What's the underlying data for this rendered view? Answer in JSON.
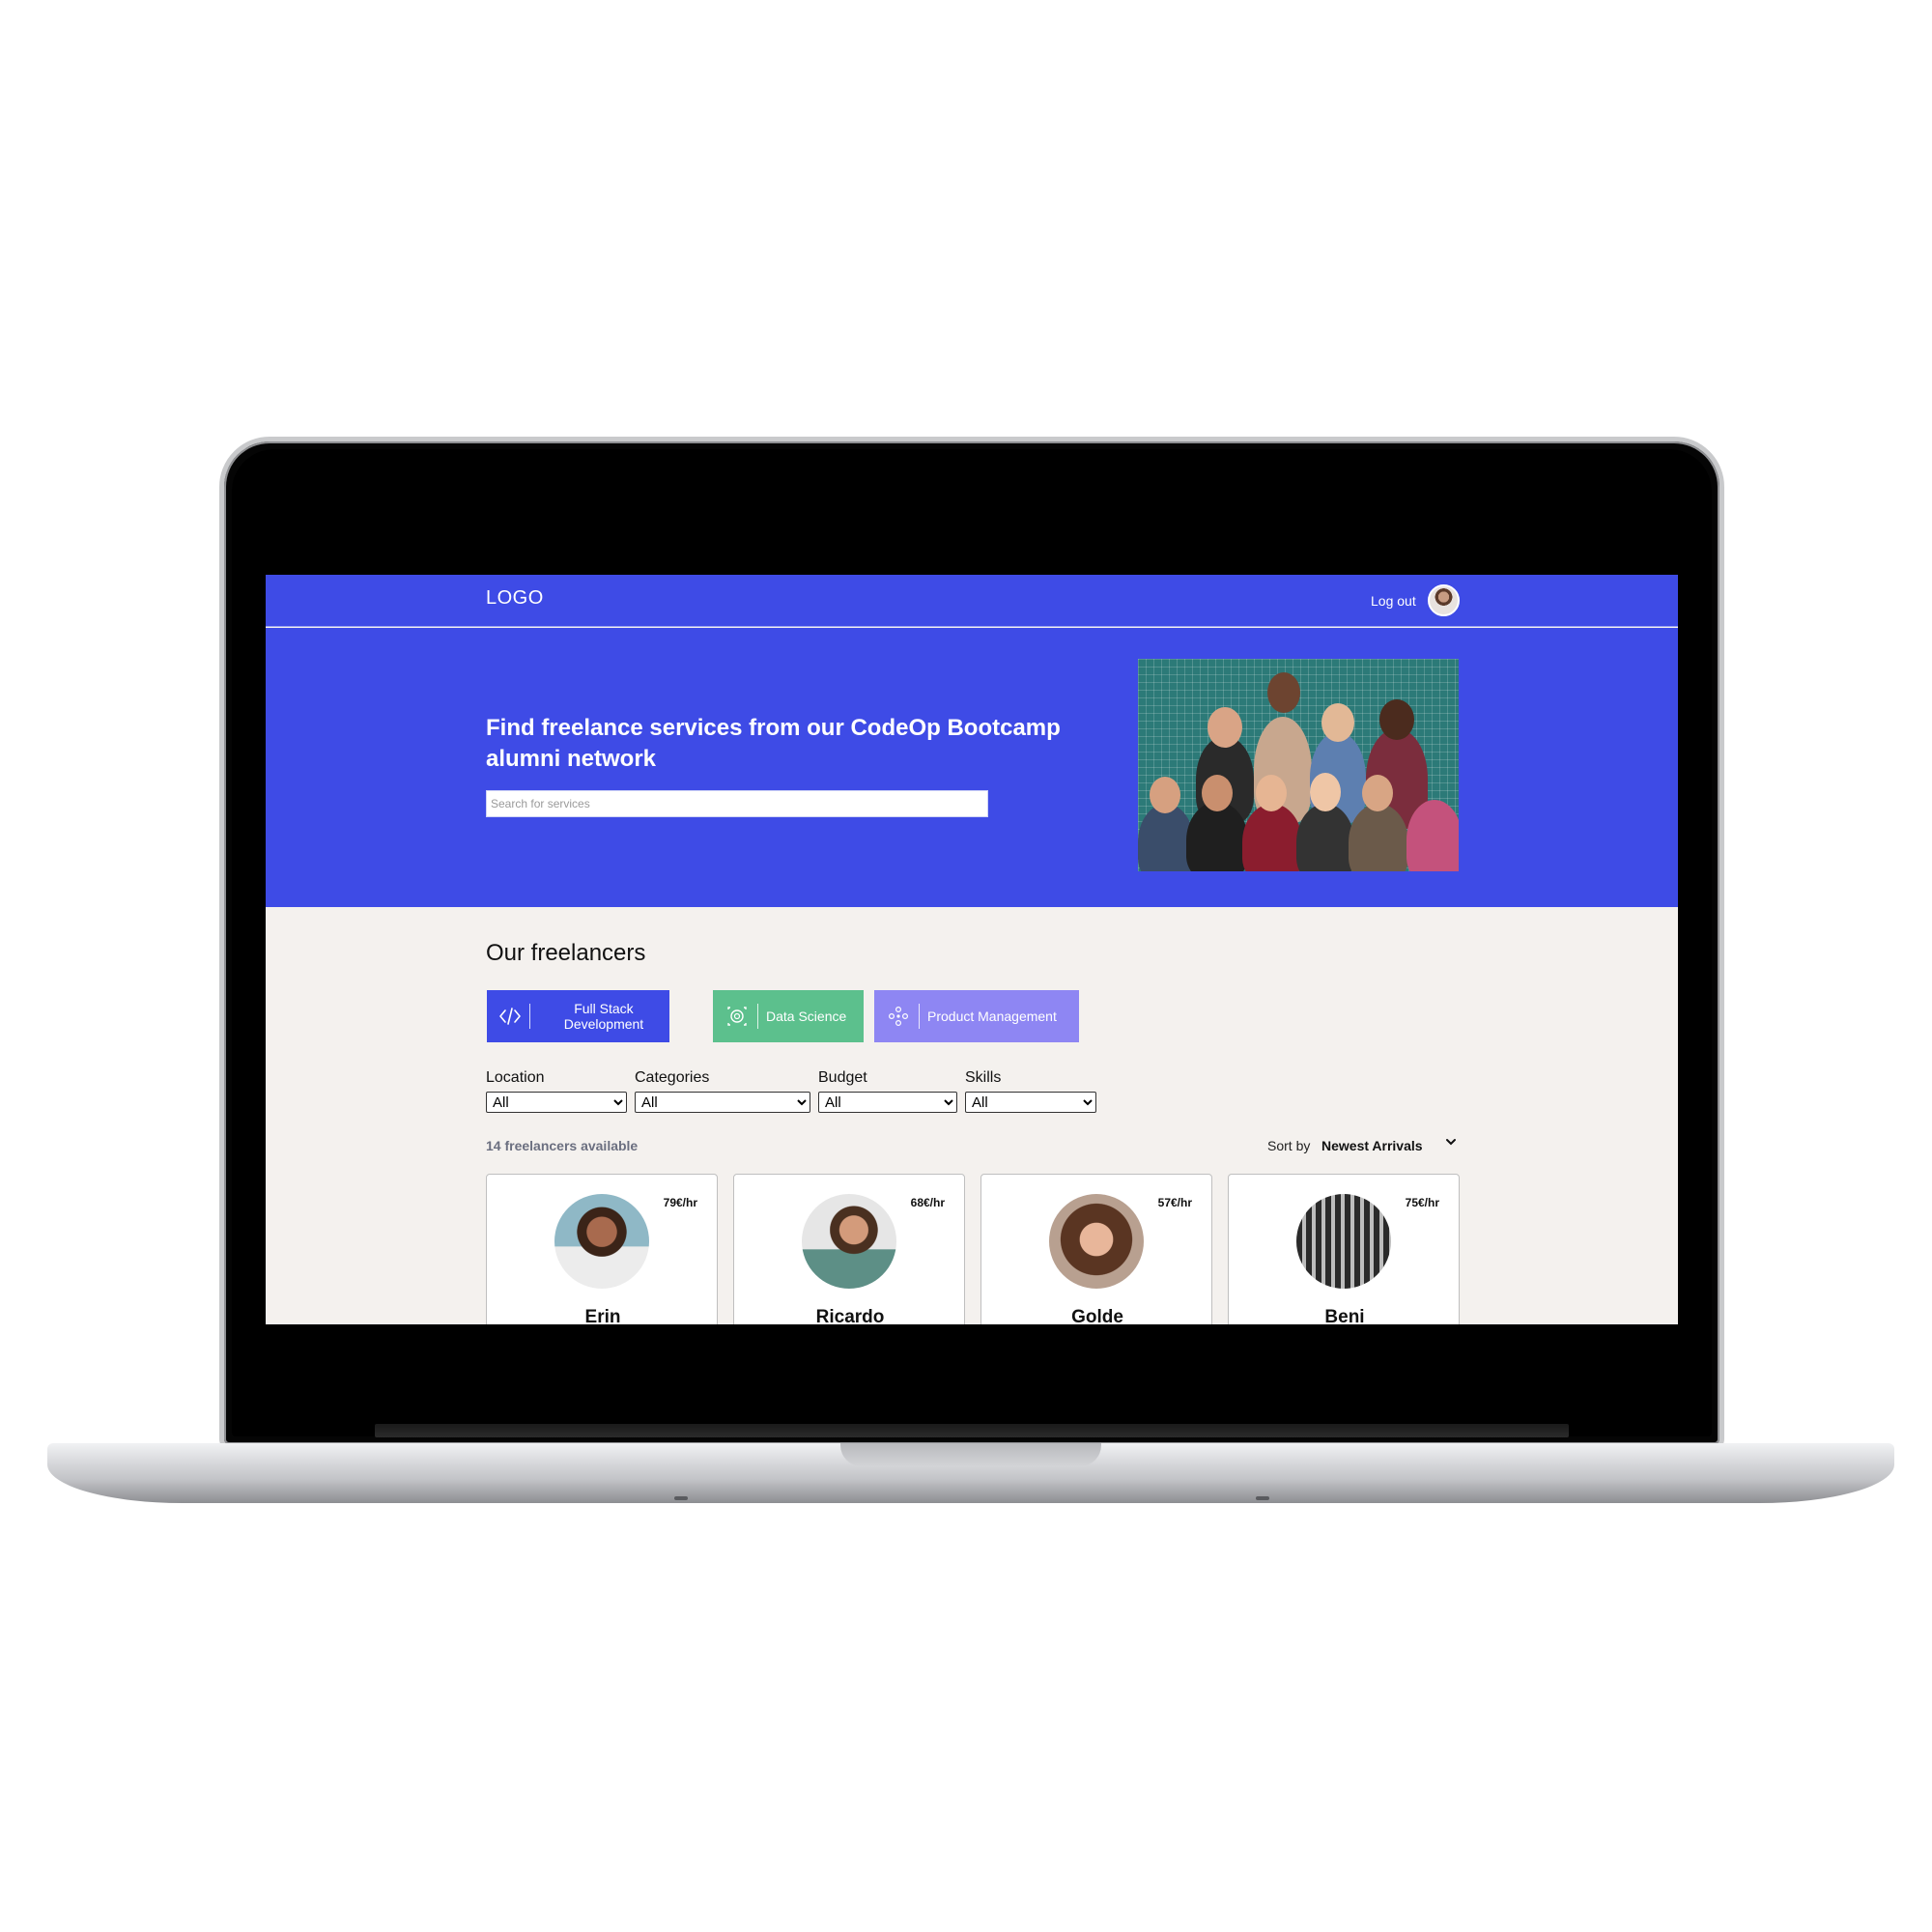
{
  "navbar": {
    "logo": "LOGO",
    "logout_label": "Log out",
    "avatar_icon": "user-avatar",
    "background": "#3e4be6"
  },
  "hero": {
    "title": "Find freelance services from our CodeOp Bootcamp alumni network",
    "search_placeholder": "Search for services",
    "search_value": "",
    "photo": "group-photo"
  },
  "freelancers": {
    "section_title": "Our freelancers",
    "categories": [
      {
        "label": "Full Stack Development",
        "icon": "code-icon",
        "color": "#3e4be6"
      },
      {
        "label": "Data Science",
        "icon": "data-science-icon",
        "color": "#5cc08d"
      },
      {
        "label": "Product Management",
        "icon": "product-management-icon",
        "color": "#8e86f3"
      }
    ],
    "filters": [
      {
        "label": "Location",
        "selected": "All"
      },
      {
        "label": "Categories",
        "selected": "All"
      },
      {
        "label": "Budget",
        "selected": "All"
      },
      {
        "label": "Skills",
        "selected": "All"
      }
    ],
    "count_text": "14 freelancers available",
    "sort": {
      "label": "Sort by",
      "value": "Newest Arrivals",
      "icon": "chevron-down-icon"
    },
    "cards": [
      {
        "name": "Erin",
        "rate": "79€/hr"
      },
      {
        "name": "Ricardo",
        "rate": "68€/hr"
      },
      {
        "name": "Golde",
        "rate": "57€/hr"
      },
      {
        "name": "Beni",
        "rate": "75€/hr"
      }
    ]
  }
}
